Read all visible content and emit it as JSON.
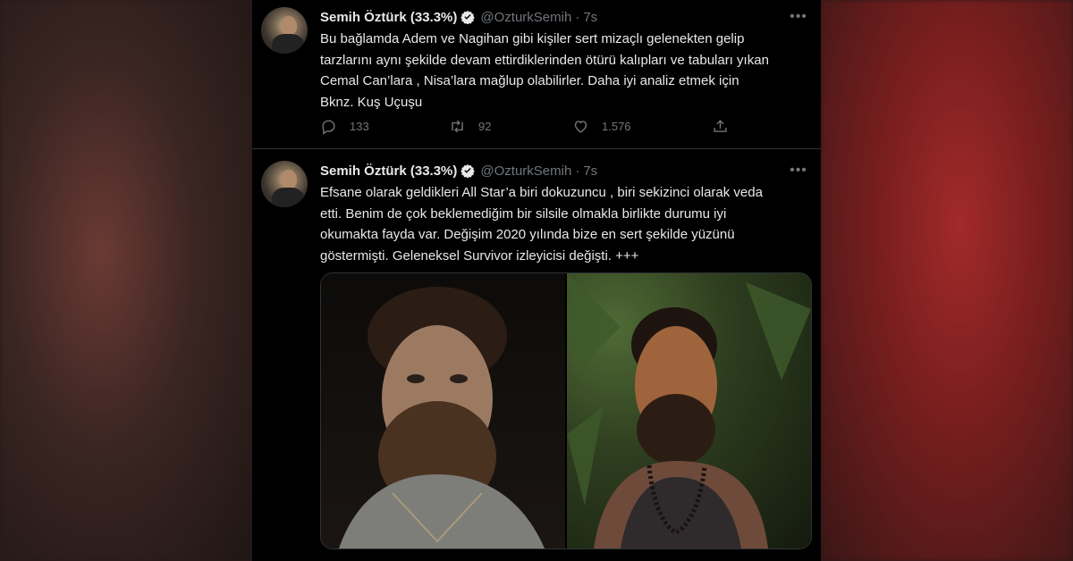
{
  "colors": {
    "panel_bg": "#000000",
    "text": "#e7e9ea",
    "muted": "#71767b",
    "verified_blue": "#1d9bf0"
  },
  "tweets": [
    {
      "author_name": "Semih Öztürk (33.3%)",
      "handle": "@OzturkSemih",
      "separator": "·",
      "time": "7s",
      "more_icon": "more-dots-icon",
      "text_lines": [
        "Bu bağlamda Adem ve Nagihan gibi kişiler sert mizaçlı gelenekten gelip",
        "tarzlarını aynı şekilde devam ettirdiklerinden ötürü kalıpları ve tabuları yıkan",
        "Cemal Can’lara , Nisa’lara mağlup olabilirler. Daha iyi analiz etmek için",
        "Bknz. Kuş Uçuşu"
      ],
      "actions": {
        "reply_count": "133",
        "retweet_count": "92",
        "like_count": "1.576"
      }
    },
    {
      "author_name": "Semih Öztürk (33.3%)",
      "handle": "@OzturkSemih",
      "separator": "·",
      "time": "7s",
      "more_icon": "more-dots-icon",
      "text_lines": [
        "Efsane olarak geldikleri All Star’a biri dokuzuncu , biri sekizinci olarak veda",
        "etti. Benim de çok beklemediğim bir silsile olmakla birlikte durumu iyi",
        "okumakta fayda var. Değişim 2020 yılında bize en sert şekilde yüzünü",
        "göstermişti. Geleneksel Survivor izleyicisi değişti. +++"
      ],
      "media": [
        "photo-bearded-man-dark",
        "photo-smiling-man-jungle"
      ]
    }
  ]
}
